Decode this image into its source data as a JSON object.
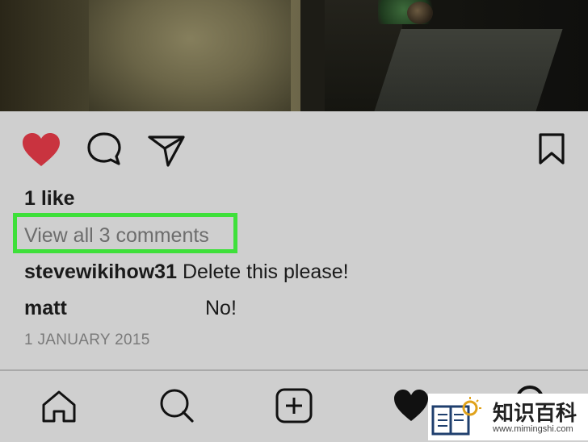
{
  "post": {
    "likes": "1 like",
    "view_comments": "View all 3 comments",
    "comments": [
      {
        "user": "stevewikihow31",
        "text": "Delete this please!"
      },
      {
        "user": "matt",
        "text": "No!"
      }
    ],
    "date": "1 JANUARY 2015"
  },
  "actions": {
    "like_icon": "heart-filled-icon",
    "comment_icon": "comment-bubble-icon",
    "share_icon": "paper-plane-icon",
    "save_icon": "bookmark-icon"
  },
  "tabbar": {
    "items": [
      "home-icon",
      "search-icon",
      "add-post-icon",
      "activity-heart-icon",
      "profile-icon"
    ]
  },
  "watermark": {
    "title": "知识百科",
    "url": "www.mimingshi.com"
  },
  "colors": {
    "background": "#cfcfcf",
    "heart": "#c9333f",
    "highlight": "#3ee03a"
  }
}
